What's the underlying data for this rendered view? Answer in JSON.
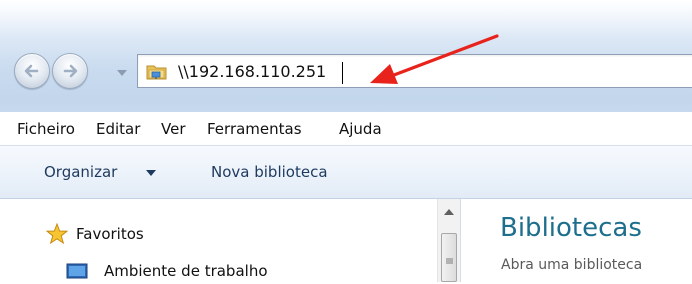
{
  "address_bar": {
    "path": "\\\\192.168.110.251"
  },
  "menu_bar": {
    "items": [
      "Ficheiro",
      "Editar",
      "Ver",
      "Ferramentas",
      "Ajuda"
    ]
  },
  "command_bar": {
    "organize_label": "Organizar",
    "new_library_label": "Nova biblioteca"
  },
  "navigation_pane": {
    "items": [
      {
        "label": "Favoritos",
        "icon": "star-icon"
      },
      {
        "label": "Ambiente de trabalho",
        "icon": "desktop-icon"
      }
    ]
  },
  "content": {
    "title": "Bibliotecas",
    "subtitle": "Abra uma biblioteca"
  },
  "colors": {
    "annotation_arrow": "#e8231c",
    "title_text": "#1e6e8e"
  }
}
